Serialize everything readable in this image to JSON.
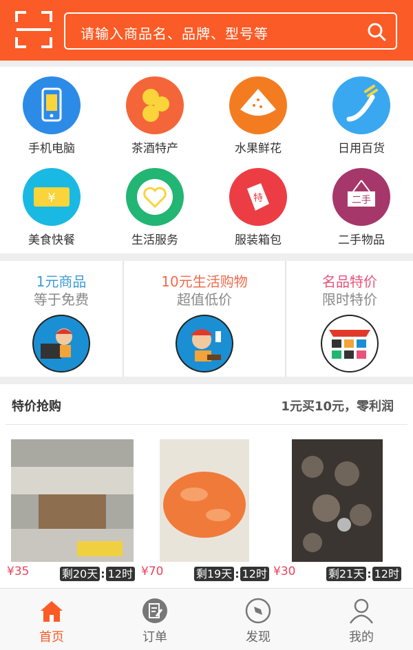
{
  "search": {
    "placeholder": "请输入商品名、品牌、型号等"
  },
  "categories": [
    {
      "label": "手机电脑",
      "icon": "phone-icon",
      "color": "#2d8be8"
    },
    {
      "label": "茶酒特产",
      "icon": "coins-icon",
      "color": "#f4663a"
    },
    {
      "label": "水果鲜花",
      "icon": "watermelon-icon",
      "color": "#f47c20"
    },
    {
      "label": "日用百货",
      "icon": "toothbrush-icon",
      "color": "#3aa8f0"
    },
    {
      "label": "美食快餐",
      "icon": "ticket-icon",
      "color": "#1ab9e3"
    },
    {
      "label": "生活服务",
      "icon": "heart-icon",
      "color": "#22b573"
    },
    {
      "label": "服装箱包",
      "icon": "tag-icon",
      "color": "#ec3d45"
    },
    {
      "label": "二手物品",
      "icon": "sign-icon",
      "color": "#a6376a",
      "sign_text": "二手"
    }
  ],
  "promos": [
    {
      "title": "1元商品",
      "subtitle": "等于免费",
      "title_color": "#3a9bd5"
    },
    {
      "title": "10元生活购物",
      "subtitle": "超值低价",
      "title_color": "#f06a4a"
    },
    {
      "title": "名品特价",
      "subtitle": "限时特价",
      "title_color": "#e9517b"
    }
  ],
  "deals": {
    "title": "特价抢购",
    "tagline": "1元买10元，零利润",
    "products": [
      {
        "price": "¥35",
        "days": "剩20天",
        "hours": "12时"
      },
      {
        "price": "¥70",
        "days": "剩19天",
        "hours": "12时"
      },
      {
        "price": "¥30",
        "days": "剩21天",
        "hours": "12时"
      }
    ]
  },
  "tabs": [
    {
      "label": "首页",
      "active": true
    },
    {
      "label": "订单"
    },
    {
      "label": "发现"
    },
    {
      "label": "我的"
    }
  ],
  "colors": {
    "brand": "#fb5b26",
    "price": "#e8445b"
  }
}
